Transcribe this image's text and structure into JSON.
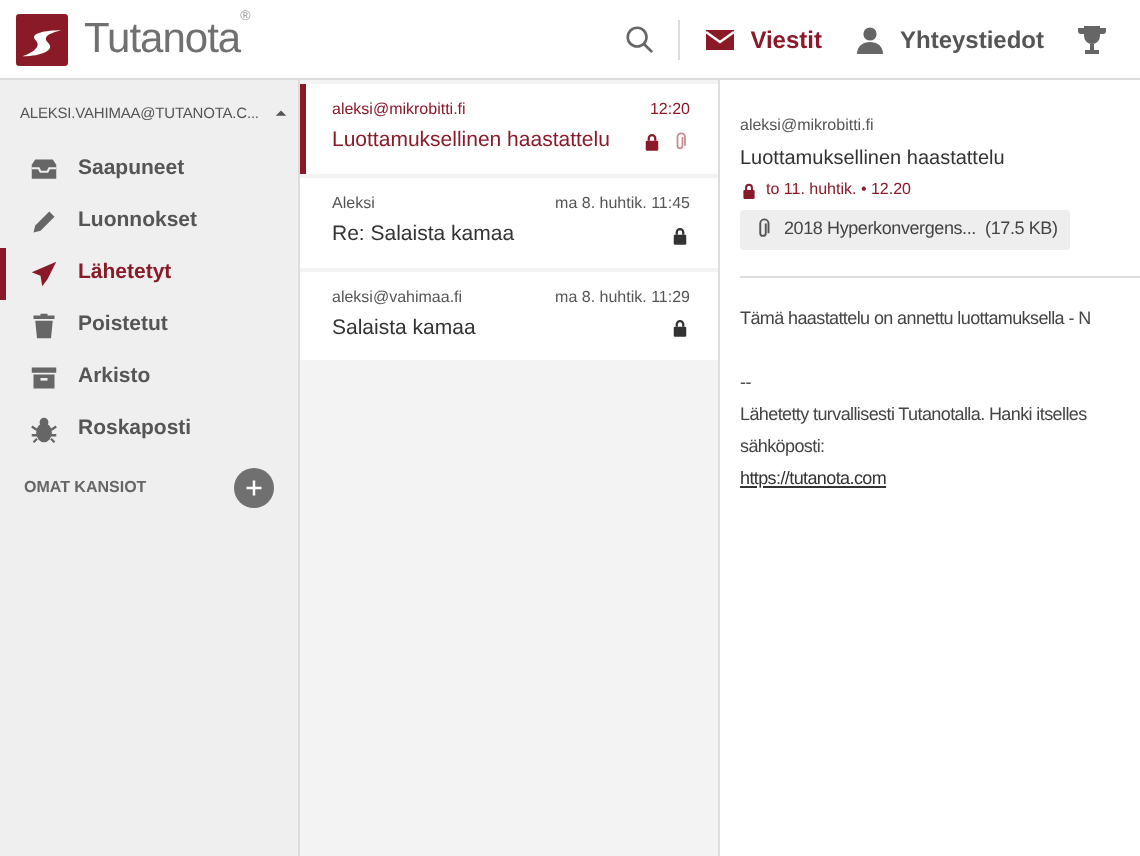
{
  "header": {
    "logo_text": "Tutanota",
    "logo_mark": "®",
    "nav": [
      {
        "kind": "search",
        "selected": false
      },
      {
        "kind": "mail",
        "label": "Viestit",
        "selected": true
      },
      {
        "kind": "contacts",
        "label": "Yhteystiedot",
        "selected": false
      },
      {
        "kind": "trophy",
        "selected": false
      }
    ]
  },
  "sidebar": {
    "account": "ALEKSI.VAHIMAA@TUTANOTA.C...",
    "expanded": true,
    "folders": [
      {
        "kind": "inbox",
        "label": "Saapuneet",
        "selected": false
      },
      {
        "kind": "draft",
        "label": "Luonnokset",
        "selected": false
      },
      {
        "kind": "sent",
        "label": "Lähetetyt",
        "selected": true
      },
      {
        "kind": "trash",
        "label": "Poistetut",
        "selected": false
      },
      {
        "kind": "archive",
        "label": "Arkisto",
        "selected": false
      },
      {
        "kind": "spam",
        "label": "Roskaposti",
        "selected": false
      }
    ],
    "own_folders": "OMAT KANSIOT"
  },
  "mail_list": [
    {
      "sender": "aleksi@mikrobitti.fi",
      "time": "12:20",
      "subject": "Luottamuksellinen haastattelu",
      "selected": true,
      "encrypted": true,
      "attachment": true
    },
    {
      "sender": "Aleksi",
      "time": "ma 8. huhtik. 11:45",
      "subject": "Re: Salaista kamaa",
      "selected": false,
      "encrypted": true,
      "attachment": false
    },
    {
      "sender": "aleksi@vahimaa.fi",
      "time": "ma 8. huhtik. 11:29",
      "subject": "Salaista kamaa",
      "selected": false,
      "encrypted": true,
      "attachment": false
    }
  ],
  "mail_view": {
    "sender": "aleksi@mikrobitti.fi",
    "subject": "Luottamuksellinen haastattelu",
    "date": "to 11. huhtik. • 12.20",
    "attachment": "2018 Hyperkonvergens...  (17.5 KB)",
    "body": [
      {
        "kind": "text",
        "text": "Tämä haastattelu on annettu luottamuksella - N"
      },
      {
        "kind": "gap"
      },
      {
        "kind": "text",
        "text": "--"
      },
      {
        "kind": "text",
        "text": "Lähetetty turvallisesti Tutanotalla. Hanki itselles"
      },
      {
        "kind": "text",
        "text": "sähköposti:"
      },
      {
        "kind": "link",
        "text": "https://tutanota.com"
      }
    ]
  }
}
